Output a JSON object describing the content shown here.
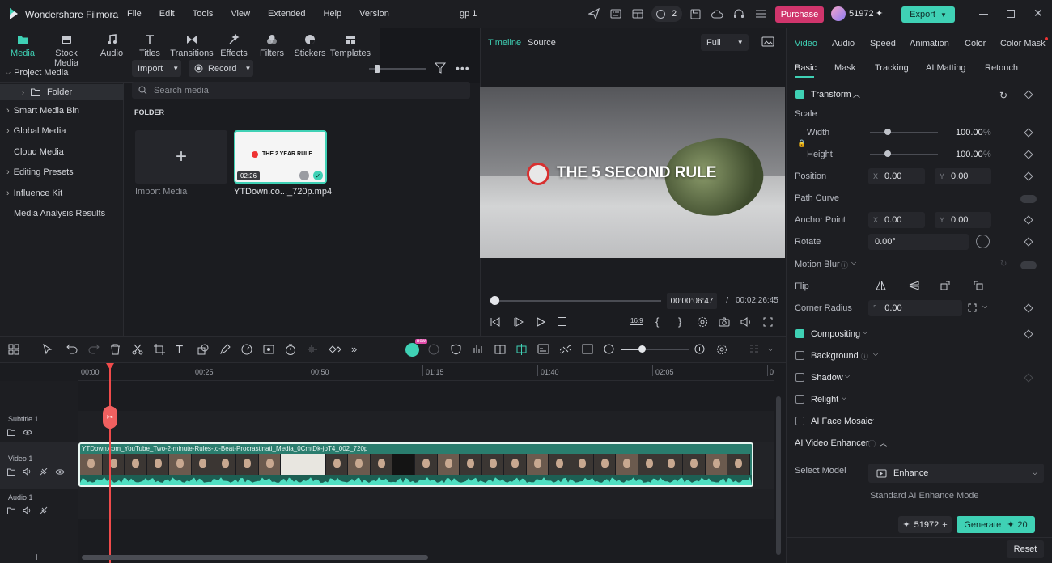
{
  "app": {
    "name": "Wondershare Filmora",
    "project_title": "gp 1",
    "menu": [
      "File",
      "Edit",
      "Tools",
      "View",
      "Extended",
      "Help",
      "Version"
    ],
    "notification_count": "2",
    "purchase_label": "Purchase",
    "credits": "51972",
    "export_label": "Export"
  },
  "toolbar": {
    "tools": [
      {
        "label": "Media",
        "icon": "media-folder-icon"
      },
      {
        "label": "Stock Media",
        "icon": "stock-media-icon"
      },
      {
        "label": "Audio",
        "icon": "music-note-icon"
      },
      {
        "label": "Titles",
        "icon": "text-t-icon"
      },
      {
        "label": "Transitions",
        "icon": "transition-icon"
      },
      {
        "label": "Effects",
        "icon": "effects-icon"
      },
      {
        "label": "Filters",
        "icon": "filters-icon"
      },
      {
        "label": "Stickers",
        "icon": "stickers-icon"
      },
      {
        "label": "Templates",
        "icon": "templates-icon"
      }
    ]
  },
  "sidebar": {
    "items": [
      "Project Media",
      "Folder",
      "Smart Media Bin",
      "Global Media",
      "Cloud Media",
      "Editing Presets",
      "Influence Kit",
      "Media Analysis Results"
    ]
  },
  "media": {
    "import_label": "Import",
    "record_label": "Record",
    "search_placeholder": "Search media",
    "folder_heading": "FOLDER",
    "import_tile_label": "Import Media",
    "clip": {
      "thumb_text": "THE 2 YEAR RULE",
      "duration": "02:26",
      "filename": "YTDown.co..._720p.mp4"
    }
  },
  "preview": {
    "tabs": [
      "Timeline",
      "Source"
    ],
    "quality": "Full",
    "overlay_text": "THE 5 SECOND RULE",
    "current_time": "00:00:06:47",
    "separator": "/",
    "total_time": "00:02:26:45",
    "progress": 0.03
  },
  "props": {
    "tabs": [
      "Video",
      "Audio",
      "Speed",
      "Animation",
      "Color",
      "Color Mask"
    ],
    "subtabs": [
      "Basic",
      "Mask",
      "Tracking",
      "AI Matting",
      "Retouch"
    ],
    "transform_label": "Transform",
    "scale_label": "Scale",
    "width_label": "Width",
    "width_value": "100.00",
    "height_label": "Height",
    "height_value": "100.00",
    "percent": "%",
    "position_label": "Position",
    "pos_x": "0.00",
    "pos_y": "0.00",
    "path_curve_label": "Path Curve",
    "anchor_label": "Anchor Point",
    "anchor_x": "0.00",
    "anchor_y": "0.00",
    "x": "X",
    "y": "Y",
    "rotate_label": "Rotate",
    "rotate_value": "0.00°",
    "motion_blur_label": "Motion Blur",
    "flip_label": "Flip",
    "corner_label": "Corner Radius",
    "corner_value": "0.00",
    "compositing_label": "Compositing",
    "background_label": "Background",
    "shadow_label": "Shadow",
    "relight_label": "Relight",
    "face_mosaic_label": "AI Face Mosaic",
    "enhancer_label": "AI Video Enhancer",
    "select_model_label": "Select Model",
    "model_value": "Enhance",
    "model_desc": "Standard AI Enhance Mode",
    "credits": "51972",
    "generate_label": "Generate",
    "generate_cost": "20",
    "reset_label": "Reset"
  },
  "timeline": {
    "ruler": [
      "00:00",
      "00:25",
      "00:50",
      "01:15",
      "01:40",
      "02:05"
    ],
    "tracks": [
      "Subtitle 1",
      "Video 1",
      "Audio 1"
    ],
    "clip_name": "YTDown.com_YouTube_Two-2-minute-Rules-to-Beat-Procrastinati_Media_0CmtDk-joT4_002_720p",
    "new_badge": "new"
  },
  "colors": {
    "accent": "#3fd1b5",
    "purchase": "#d0356c",
    "playhead": "#f04b4b",
    "clip": "#2a7d6e"
  }
}
